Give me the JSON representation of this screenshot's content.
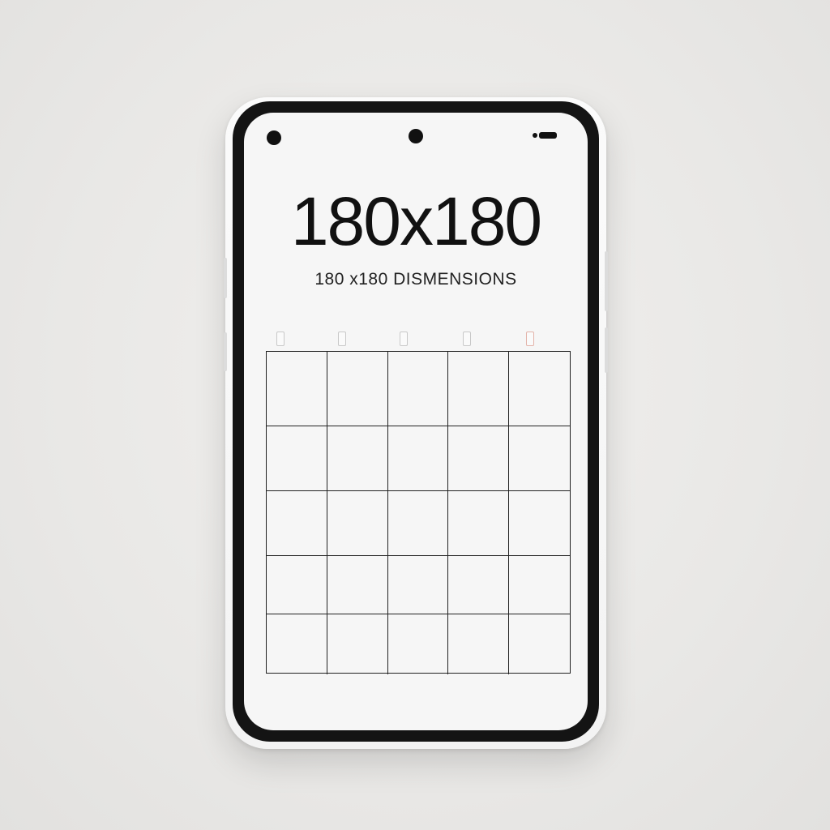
{
  "screen": {
    "title": "180x180",
    "subtitle": "180 x180 DISMENSIONS"
  },
  "icons": {
    "front_camera": "camera-icon",
    "left_sensor": "sensor-icon",
    "status": "status-indicator-icon"
  },
  "grid": {
    "rows": 5,
    "columns": 5
  },
  "colors": {
    "background": "#e9e8e6",
    "phone_shell": "#f7f7f7",
    "bezel": "#141414",
    "screen": "#f6f6f6",
    "grid_line": "#222222",
    "text": "#111111"
  }
}
